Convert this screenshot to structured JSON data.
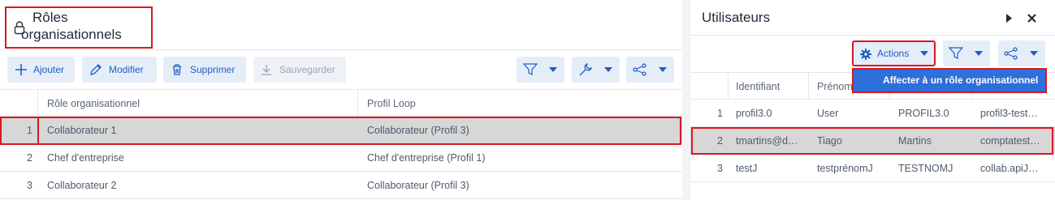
{
  "left": {
    "title_line1": "Rôles",
    "title_line2": "organisationnels",
    "toolbar": {
      "add_label": "Ajouter",
      "edit_label": "Modifier",
      "delete_label": "Supprimer",
      "save_label": "Sauvegarder"
    },
    "columns": [
      "Rôle organisationnel",
      "Profil Loop"
    ],
    "rows": [
      {
        "num": "1",
        "role": "Collaborateur 1",
        "profile": "Collaborateur (Profil 3)"
      },
      {
        "num": "2",
        "role": "Chef d'entreprise",
        "profile": "Chef d'entreprise (Profil 1)"
      },
      {
        "num": "3",
        "role": "Collaborateur 2",
        "profile": "Collaborateur (Profil 3)"
      }
    ]
  },
  "right": {
    "title": "Utilisateurs",
    "actions_label": "Actions",
    "menu_item": "Affecter à un rôle organisationnel",
    "columns": [
      "Identifiant",
      "Prénom"
    ],
    "rows": [
      {
        "num": "1",
        "id": "profil3.0",
        "first": "User",
        "last": "PROFIL3.0",
        "email": "profil3-test…"
      },
      {
        "num": "2",
        "id": "tmartins@d…",
        "first": "Tiago",
        "last": "Martins",
        "email": "comptatest…"
      },
      {
        "num": "3",
        "id": "testJ",
        "first": "testprénomJ",
        "last": "TESTNOMJ",
        "email": "collab.apiJ…"
      }
    ]
  },
  "colors": {
    "accent": "#1d5fbf",
    "highlight": "#d71920",
    "menu_bg": "#2e6fd9",
    "selected_row": "#d7d7d7"
  }
}
